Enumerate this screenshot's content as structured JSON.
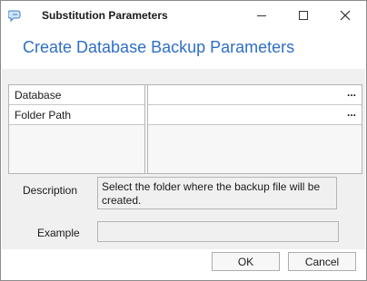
{
  "window": {
    "title": "Substitution Parameters",
    "controls": {
      "minimize": "minimize-icon",
      "maximize": "maximize-icon",
      "close": "close-icon"
    }
  },
  "heading": "Create Database Backup Parameters",
  "parameters": {
    "rows": [
      {
        "name": "Database",
        "value": "",
        "button": "..."
      },
      {
        "name": "Folder Path",
        "value": "",
        "button": "..."
      }
    ]
  },
  "description": {
    "label": "Description",
    "text": "Select the folder where the backup file will be created."
  },
  "example": {
    "label": "Example",
    "text": ""
  },
  "buttons": {
    "ok": "OK",
    "cancel": "Cancel"
  },
  "colors": {
    "heading": "#2e6fc3",
    "content_bg": "#f0f0f0",
    "border": "#b5b5b5"
  }
}
